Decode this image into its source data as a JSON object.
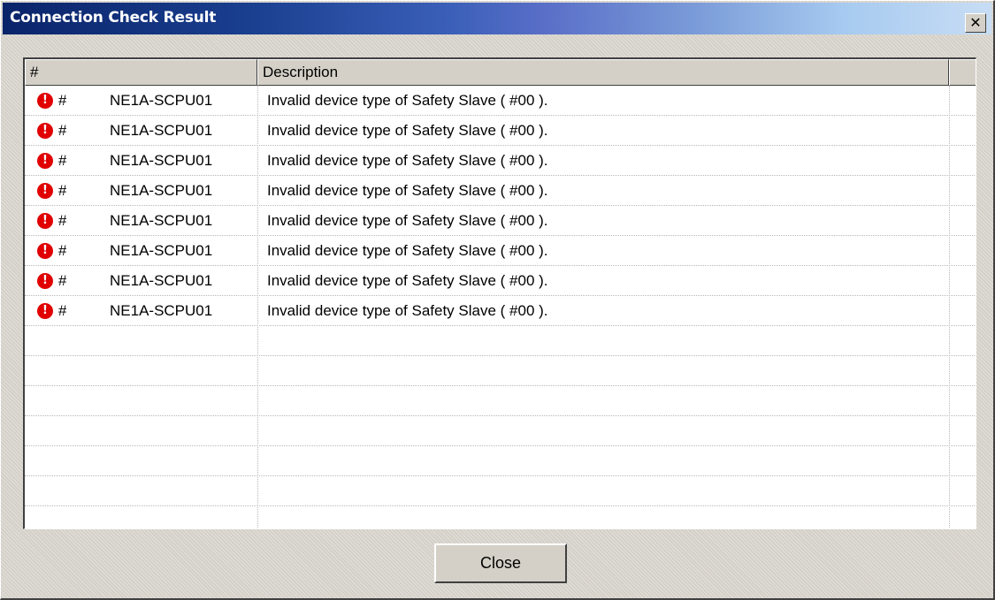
{
  "window": {
    "title": "Connection Check Result",
    "close_glyph": "✕"
  },
  "table": {
    "columns": [
      {
        "label": "#"
      },
      {
        "label": "Description"
      },
      {
        "label": ""
      }
    ],
    "rows": [
      {
        "icon": "error-icon",
        "hash": "#",
        "device": "NE1A-SCPU01",
        "description": "Invalid device type of Safety Slave ( #00 )."
      },
      {
        "icon": "error-icon",
        "hash": "#",
        "device": "NE1A-SCPU01",
        "description": "Invalid device type of Safety Slave ( #00 )."
      },
      {
        "icon": "error-icon",
        "hash": "#",
        "device": "NE1A-SCPU01",
        "description": "Invalid device type of Safety Slave ( #00 )."
      },
      {
        "icon": "error-icon",
        "hash": "#",
        "device": "NE1A-SCPU01",
        "description": "Invalid device type of Safety Slave ( #00 )."
      },
      {
        "icon": "error-icon",
        "hash": "#",
        "device": "NE1A-SCPU01",
        "description": "Invalid device type of Safety Slave ( #00 )."
      },
      {
        "icon": "error-icon",
        "hash": "#",
        "device": "NE1A-SCPU01",
        "description": "Invalid device type of Safety Slave ( #00 )."
      },
      {
        "icon": "error-icon",
        "hash": "#",
        "device": "NE1A-SCPU01",
        "description": "Invalid device type of Safety Slave ( #00 )."
      },
      {
        "icon": "error-icon",
        "hash": "#",
        "device": "NE1A-SCPU01",
        "description": "Invalid device type of Safety Slave ( #00 )."
      }
    ],
    "empty_row_count": 7
  },
  "footer": {
    "close_label": "Close"
  },
  "colors": {
    "titlebar_start": "#0a246a",
    "titlebar_end": "#a6caf0",
    "error_red": "#e00000",
    "dialog_face": "#d4d0c8"
  }
}
